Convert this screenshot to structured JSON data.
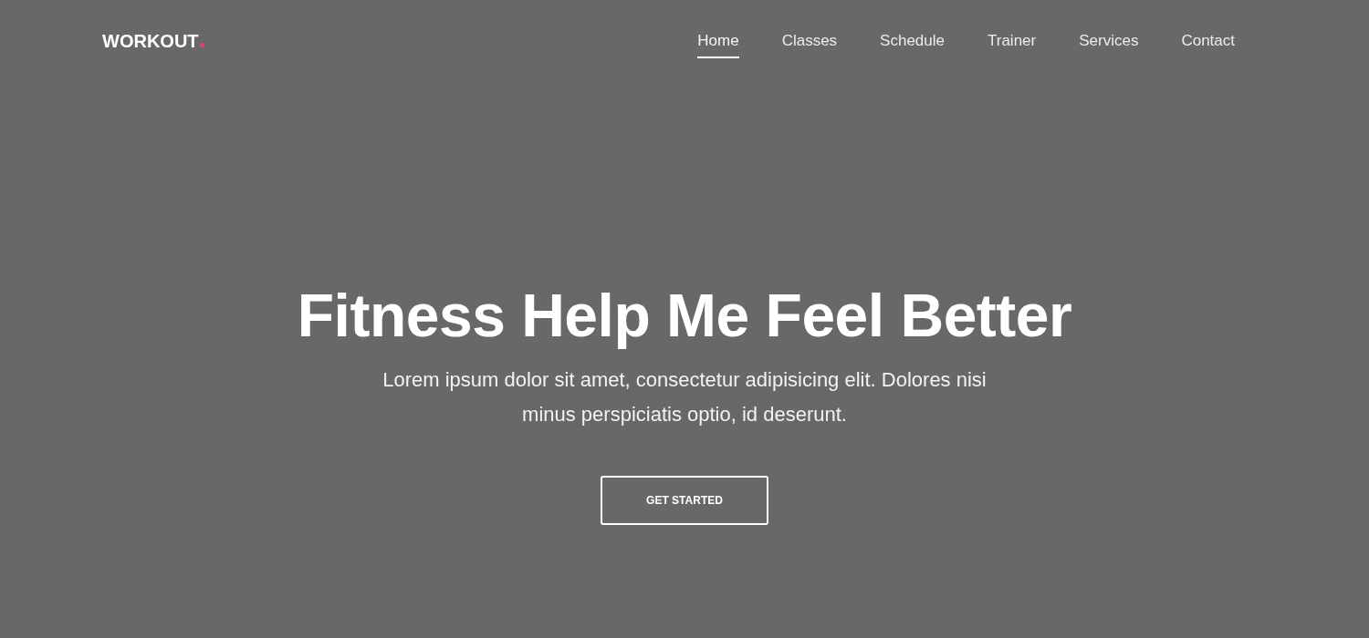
{
  "logo": {
    "text": "WORKOUT"
  },
  "nav": [
    {
      "label": "Home",
      "selected": true
    },
    {
      "label": "Classes",
      "selected": false
    },
    {
      "label": "Schedule",
      "selected": false
    },
    {
      "label": "Trainer",
      "selected": false
    },
    {
      "label": "Services",
      "selected": false
    },
    {
      "label": "Contact",
      "selected": false
    }
  ],
  "hero": {
    "title": "Fitness Help Me Feel Better",
    "text": "Lorem ipsum dolor sit amet, consectetur adipisicing elit. Dolores nisi minus perspiciatis optio, id deserunt.",
    "button": "GET STARTED"
  }
}
